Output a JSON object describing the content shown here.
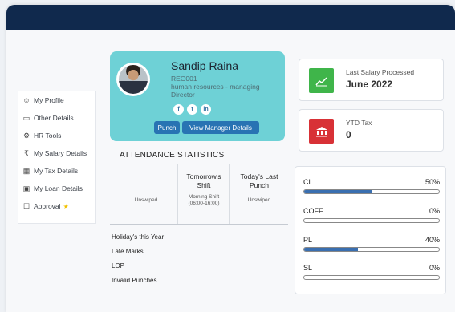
{
  "profile": {
    "name": "Sandip Raina",
    "employee_id": "REG001",
    "department": "human resources - managing",
    "designation": "Director",
    "socials": [
      {
        "icon": "facebook-icon",
        "glyph": "f"
      },
      {
        "icon": "twitter-icon",
        "glyph": "t"
      },
      {
        "icon": "linkedin-icon",
        "glyph": "in"
      }
    ],
    "punch_label": "Punch",
    "manager_label": "View Manager Details"
  },
  "sidebar": {
    "items": [
      {
        "label": "My Profile",
        "icon": "user-icon",
        "glyph": "☺"
      },
      {
        "label": "Other Details",
        "icon": "folder-icon",
        "glyph": "▭"
      },
      {
        "label": "HR Tools",
        "icon": "tools-icon",
        "glyph": "⚙"
      },
      {
        "label": "My Salary Details",
        "icon": "rupee-icon",
        "glyph": "₹"
      },
      {
        "label": "My Tax Details",
        "icon": "calculator-icon",
        "glyph": "▦"
      },
      {
        "label": "My Loan Details",
        "icon": "wallet-icon",
        "glyph": "▣"
      },
      {
        "label": "Approval",
        "icon": "approval-icon",
        "glyph": "☐"
      }
    ]
  },
  "attendance": {
    "title": "ATTENDANCE STATISTICS",
    "col_tomorrow": "Tomorrow's Shift",
    "col_last_punch": "Today's Last Punch",
    "today_status": "Unswiped",
    "tomorrow_shift": "Morning Shift (06:00-16:00)",
    "last_punch": "Unswiped",
    "stats": [
      "Holiday's this Year",
      "Late Marks",
      "LOP",
      "Invalid Punches"
    ]
  },
  "salary": {
    "label": "Last Salary Processed",
    "value": "June 2022",
    "icon": "chart-up-icon",
    "color": "#3fb54a"
  },
  "tax": {
    "label": "YTD Tax",
    "value": "0",
    "icon": "bank-icon",
    "color": "#d83136"
  },
  "leaves": [
    {
      "name": "CL",
      "percent_label": "50%",
      "fraction": 0.5
    },
    {
      "name": "COFF",
      "percent_label": "0%",
      "fraction": 0
    },
    {
      "name": "PL",
      "percent_label": "40%",
      "fraction": 0.4
    },
    {
      "name": "SL",
      "percent_label": "0%",
      "fraction": 0
    }
  ],
  "colors": {
    "topbar": "#10294d",
    "profile_card": "#6ed1d6",
    "button": "#2873b3",
    "bar_fill": "#3a6fb0"
  }
}
